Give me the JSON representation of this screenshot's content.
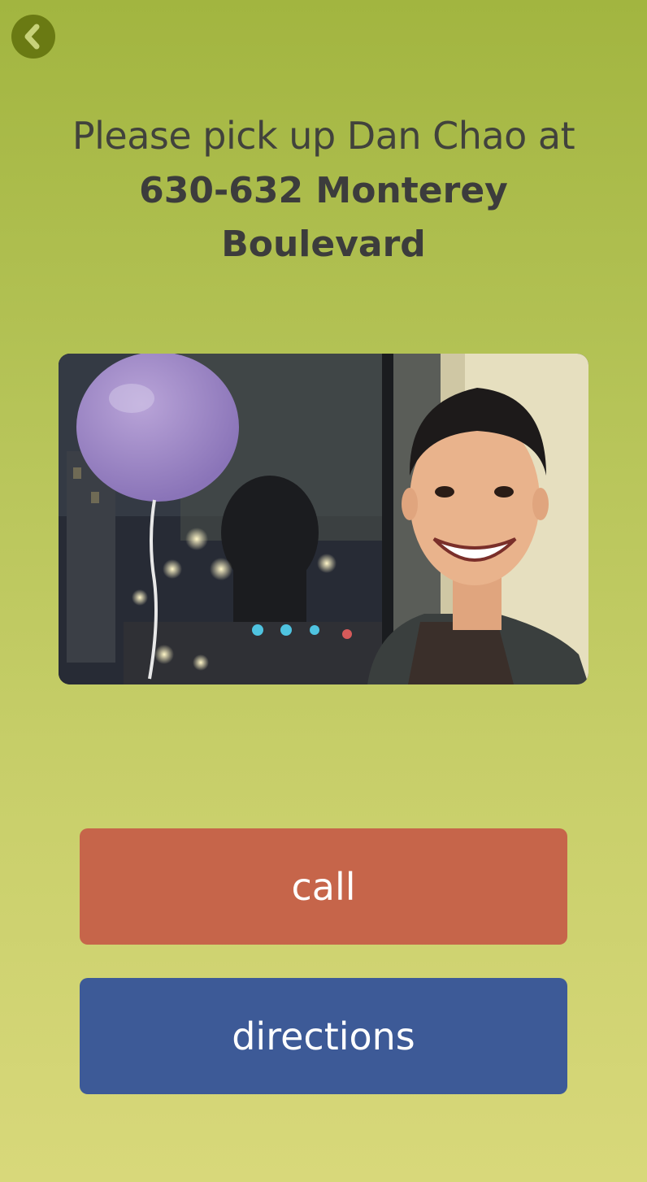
{
  "nav": {
    "back_icon": "chevron-left-icon"
  },
  "pickup": {
    "lead": "Please pick up Dan Chao at",
    "address": "630-632 Monterey Boulevard"
  },
  "photo": {
    "subject": "passenger-photo"
  },
  "actions": {
    "call_label": "call",
    "directions_label": "directions"
  },
  "colors": {
    "background_top": "#a2b540",
    "background_bottom": "#d8d87a",
    "back_button": "#6a7a13",
    "call_button": "#c6654a",
    "directions_button": "#3d5a97",
    "text_dark": "#3c3c3c"
  }
}
